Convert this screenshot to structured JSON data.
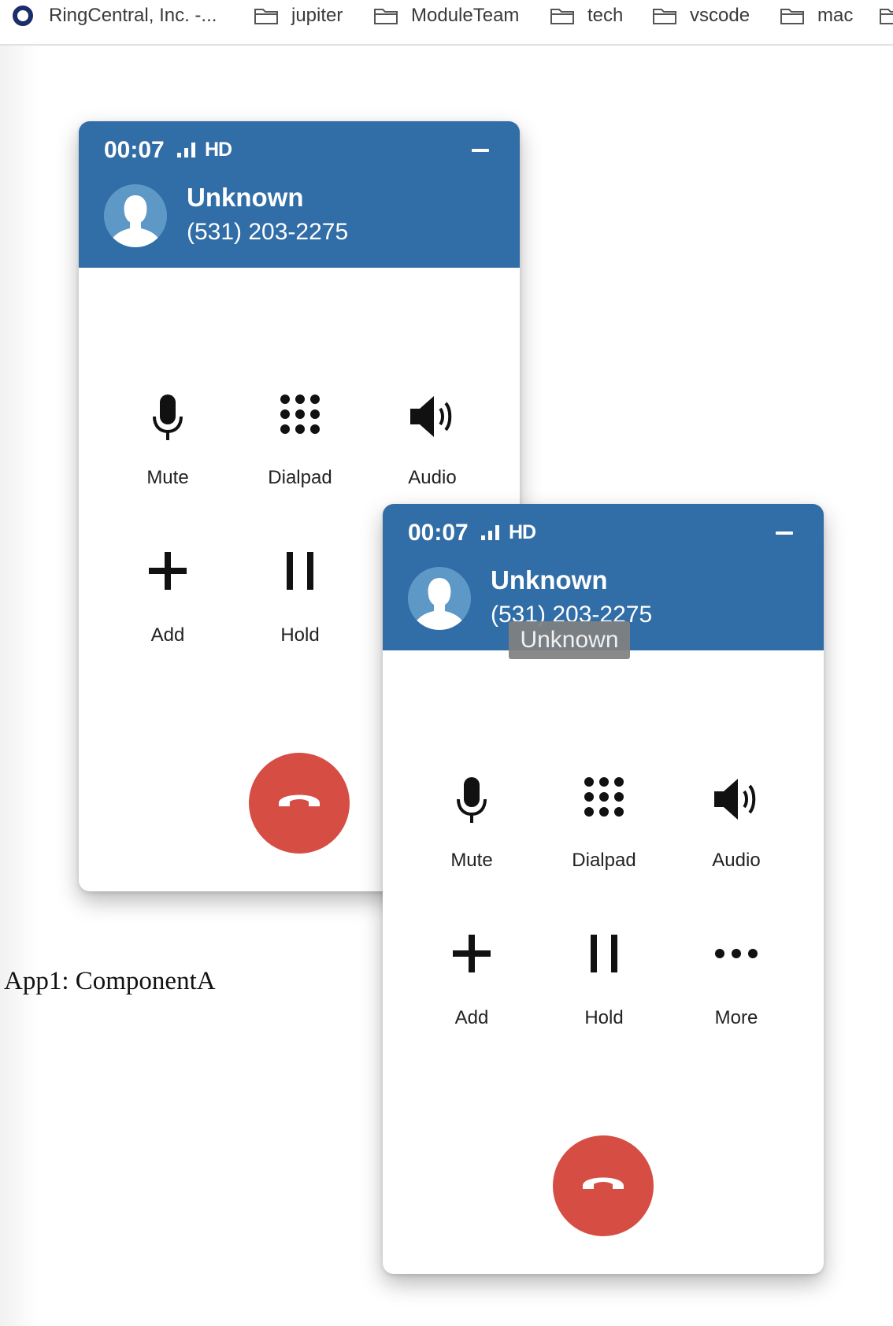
{
  "bookmarks": {
    "items": [
      {
        "label": "RingCentral, Inc. -...",
        "icon": "ringcentral-icon"
      },
      {
        "label": "jupiter",
        "icon": "folder-icon"
      },
      {
        "label": "ModuleTeam",
        "icon": "folder-icon"
      },
      {
        "label": "tech",
        "icon": "folder-icon"
      },
      {
        "label": "vscode",
        "icon": "folder-icon"
      },
      {
        "label": "mac",
        "icon": "folder-icon"
      }
    ]
  },
  "app_label": "App1: ComponentA",
  "calls": [
    {
      "timer": "00:07",
      "quality": "HD",
      "caller_name": "Unknown",
      "caller_number": "(531) 203-2275",
      "controls": {
        "mute": "Mute",
        "dialpad": "Dialpad",
        "audio": "Audio",
        "add": "Add",
        "hold": "Hold"
      }
    },
    {
      "timer": "00:07",
      "quality": "HD",
      "caller_name": "Unknown",
      "caller_number": "(531) 203-2275",
      "tooltip": "Unknown",
      "controls": {
        "mute": "Mute",
        "dialpad": "Dialpad",
        "audio": "Audio",
        "add": "Add",
        "hold": "Hold",
        "more": "More"
      }
    }
  ],
  "colors": {
    "header": "#316da6",
    "hangup": "#d54d43",
    "avatar": "#5e98c7"
  }
}
